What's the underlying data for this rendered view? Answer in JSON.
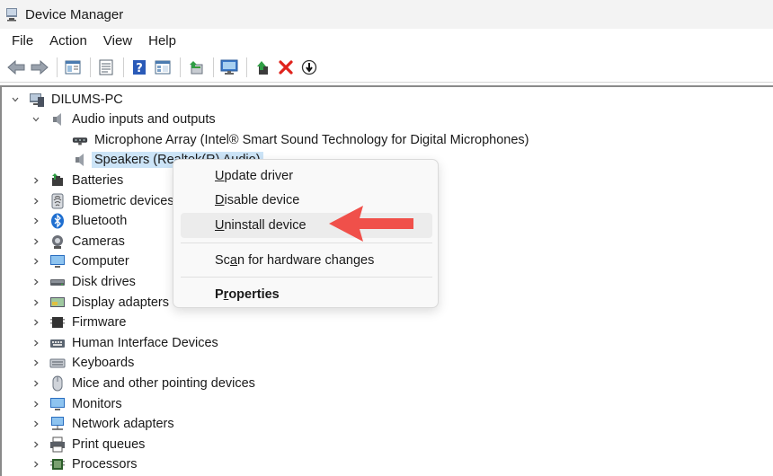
{
  "window": {
    "title": "Device Manager"
  },
  "menubar": [
    "File",
    "Action",
    "View",
    "Help"
  ],
  "toolbar": {
    "buttons": [
      "back-icon",
      "forward-icon",
      "properties-icon",
      "list-icon",
      "help-icon",
      "details-icon",
      "update-driver-icon",
      "scan-icon",
      "enable-device-icon",
      "uninstall-icon",
      "disable-icon"
    ]
  },
  "tree": {
    "root": "DILUMS-PC",
    "audio": {
      "label": "Audio inputs and outputs",
      "children": [
        "Microphone Array (Intel® Smart Sound Technology for Digital Microphones)",
        "Speakers (Realtek(R) Audio)"
      ]
    },
    "categories": [
      "Batteries",
      "Biometric devices",
      "Bluetooth",
      "Cameras",
      "Computer",
      "Disk drives",
      "Display adapters",
      "Firmware",
      "Human Interface Devices",
      "Keyboards",
      "Mice and other pointing devices",
      "Monitors",
      "Network adapters",
      "Print queues",
      "Processors"
    ]
  },
  "context_menu": {
    "update": {
      "pre": "",
      "ul": "U",
      "post": "pdate driver"
    },
    "disable": {
      "pre": "",
      "ul": "D",
      "post": "isable device"
    },
    "uninstall": {
      "pre": "",
      "ul": "U",
      "post": "ninstall device"
    },
    "scan": {
      "pre": "Sc",
      "ul": "a",
      "post": "n for hardware changes"
    },
    "properties": {
      "pre": "P",
      "ul": "r",
      "post": "operties"
    }
  },
  "colors": {
    "selection": "#cce4f7",
    "callout": "#f0504a",
    "accent": "#0078d4"
  }
}
